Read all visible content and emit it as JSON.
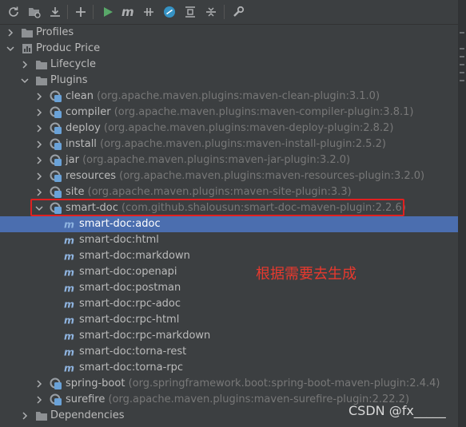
{
  "toolbar": {
    "buttons": [
      {
        "name": "reload-icon"
      },
      {
        "name": "reimport-folder-icon"
      },
      {
        "name": "download-sources-icon"
      },
      {
        "name": "add-icon"
      },
      {
        "name": "run-icon"
      },
      {
        "name": "execute-goal-icon"
      },
      {
        "name": "toggle-offline-icon"
      },
      {
        "name": "skip-tests-icon"
      },
      {
        "name": "show-dependencies-icon"
      },
      {
        "name": "collapse-all-icon"
      },
      {
        "name": "settings-wrench-icon"
      }
    ]
  },
  "tree": {
    "profiles": "Profiles",
    "project": "Produc Price",
    "lifecycle": "Lifecycle",
    "plugins": "Plugins",
    "plugin_list_top": [
      {
        "name": "clean",
        "coord": "(org.apache.maven.plugins:maven-clean-plugin:3.1.0)"
      },
      {
        "name": "compiler",
        "coord": "(org.apache.maven.plugins:maven-compiler-plugin:3.8.1)"
      },
      {
        "name": "deploy",
        "coord": "(org.apache.maven.plugins:maven-deploy-plugin:2.8.2)"
      },
      {
        "name": "install",
        "coord": "(org.apache.maven.plugins:maven-install-plugin:2.5.2)"
      },
      {
        "name": "jar",
        "coord": "(org.apache.maven.plugins:maven-jar-plugin:3.2.0)"
      },
      {
        "name": "resources",
        "coord": "(org.apache.maven.plugins:maven-resources-plugin:3.2.0)"
      },
      {
        "name": "site",
        "coord": "(org.apache.maven.plugins:maven-site-plugin:3.3)"
      }
    ],
    "smart_doc": {
      "name": "smart-doc",
      "coord": "(com.github.shalousun:smart-doc-maven-plugin:2.2.6)"
    },
    "goals": [
      "smart-doc:adoc",
      "smart-doc:html",
      "smart-doc:markdown",
      "smart-doc:openapi",
      "smart-doc:postman",
      "smart-doc:rpc-adoc",
      "smart-doc:rpc-html",
      "smart-doc:rpc-markdown",
      "smart-doc:torna-rest",
      "smart-doc:torna-rpc"
    ],
    "plugin_list_bottom": [
      {
        "name": "spring-boot",
        "coord": "(org.springframework.boot:spring-boot-maven-plugin:2.4.4)"
      },
      {
        "name": "surefire",
        "coord": "(org.apache.maven.plugins:maven-surefire-plugin:2.22.2)"
      }
    ],
    "dependencies": "Dependencies"
  },
  "annotation": "根据需要去生成",
  "watermark": "CSDN @fx_____",
  "colors": {
    "selection": "#4b6eaf",
    "annotation": "#e8392e",
    "run_green": "#59a869"
  }
}
